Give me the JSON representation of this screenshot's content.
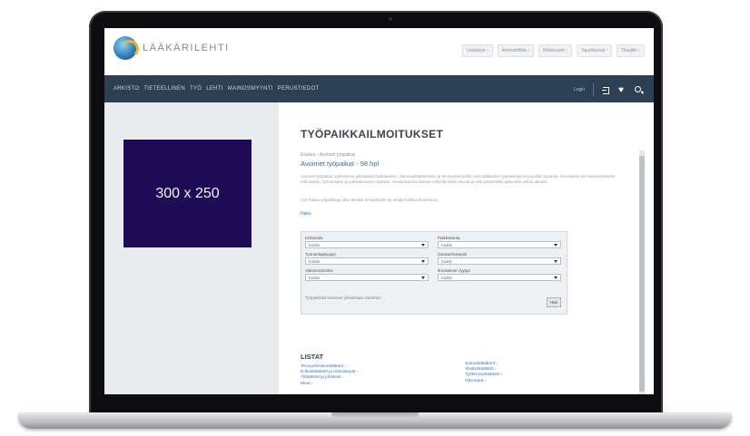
{
  "site": {
    "logo_text": "LÄÄKÄRILEHTI",
    "top_nav": [
      "Uutiskirje ›",
      "Ammattiliitto ›",
      "Webinaarit ›",
      "Tapahtumat ›",
      "Tilaajille ›"
    ],
    "main_nav": [
      "ARKISTO",
      "TIETEELLINEN",
      "TYÖ",
      "LEHTI",
      "MAINOSMYYNTI",
      "PERUSTIEDOT"
    ],
    "nav_right": {
      "login_label": "Login",
      "login_icon": "login-icon",
      "favorites_icon": "heart-icon",
      "search_icon": "search-icon"
    }
  },
  "ad": {
    "label": "300 x 250",
    "color": "#1d0b55"
  },
  "page": {
    "title": "TYÖPAIKKAILMOITUKSET",
    "breadcrumb": "Etusivu › Avoimet työpaikat",
    "subheading": "Avoimet työpaikat - 98 hpl",
    "paragraph_1": "Avoimet työpaikat -palvelussa julkaistaan lääkäreiden, hammaslääkäreiden ja terveydenhuollon ammattilaisten työpaikkoja eri puolilta Suomea. Ilmoituksia voi hakea tehtävän, erikoisalan, työnantajan ja paikkakunnan mukaan. Uusimmat ilmoitukset näkyvät listan alussa ja niitä päivitetään jatkuvasti viikon aikana.",
    "paragraph_2": "Voit hakea työpaikkoja alla olevalla lomakkeella tai selata kaikkia ilmoituksia.",
    "link_label": "Haku"
  },
  "filters": {
    "fields": [
      {
        "label": "Erikoisala",
        "value": "Kaikki"
      },
      {
        "label": "Paikkakunta",
        "value": "Kaikki"
      },
      {
        "label": "Työnantajatyyppi",
        "value": "Kaikki"
      },
      {
        "label": "Sairaanhoitopiiri",
        "value": "Kaikki"
      },
      {
        "label": "Vakanssinimike",
        "value": "Kaikki"
      },
      {
        "label": "Ilmoituksen tyyppi",
        "value": "Kaikki"
      }
    ],
    "note": "Työpaikkailmoitukset julkaistaan viikoittain",
    "search_button": "Hae"
  },
  "lists": {
    "title": "LISTAT",
    "col_1": [
      "Terveyskeskuslääkärit ›",
      "Erikoislääkärit ja erikoistuvat ›",
      "Ylilääkärit ja johtavat ›",
      "Muut ›"
    ],
    "col_2": [
      "Sairaalalääkärit ›",
      "Yksityislääkärit ›",
      "Työterveyslääkärit ›",
      "Ulkomaat ›"
    ]
  }
}
